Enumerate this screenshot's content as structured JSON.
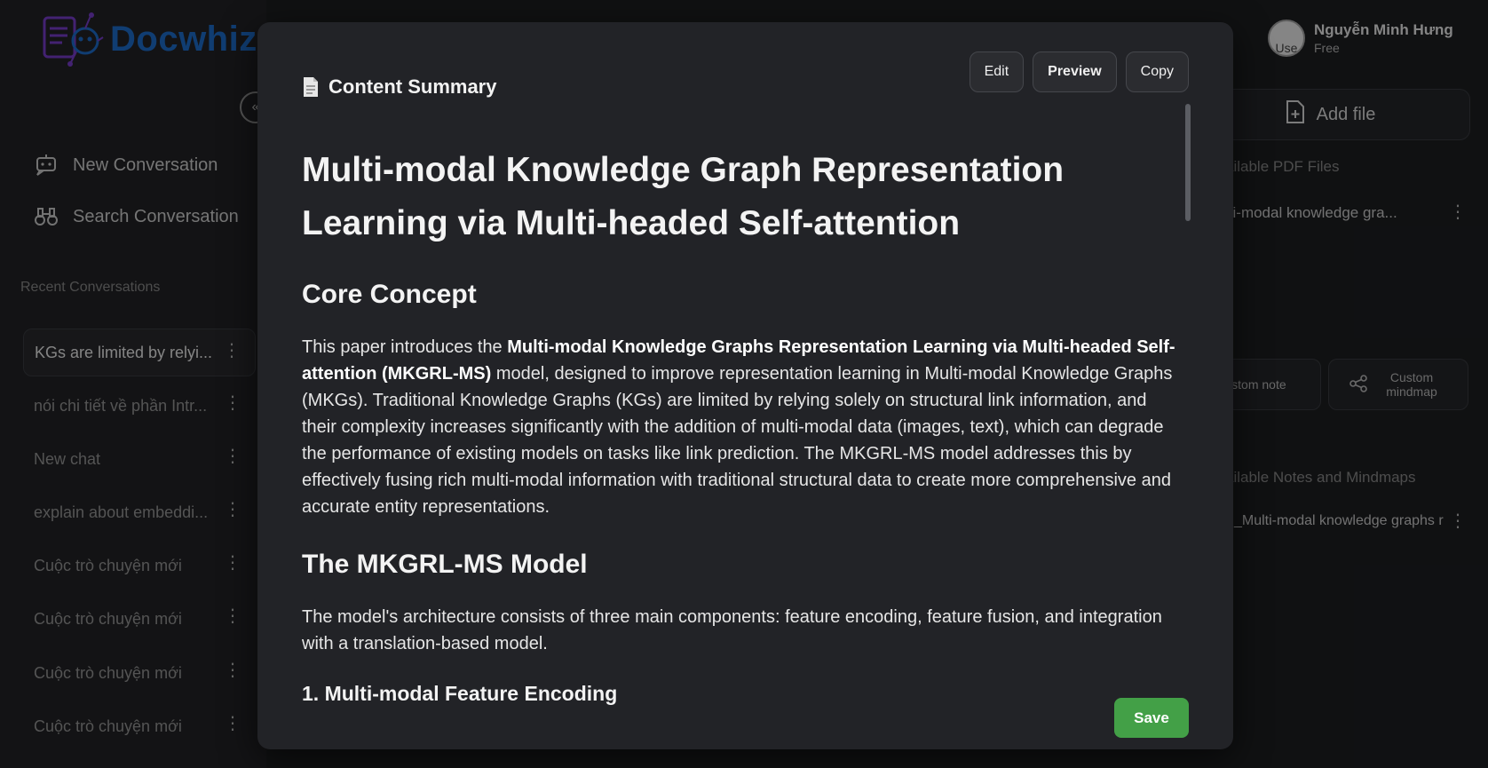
{
  "app": {
    "brand": "Docwhiz",
    "sidebar": {
      "new_conversation": "New Conversation",
      "search_conversation": "Search Conversation",
      "recent_title": "Recent Conversations",
      "conversations": [
        "KGs are limited by relyi...",
        "nói chi tiết về phần Intr...",
        "New chat",
        "explain about embeddi...",
        "Cuộc trò chuyện mới",
        "Cuộc trò chuyện mới",
        "Cuộc trò chuyện mới",
        "Cuộc trò chuyện mới"
      ]
    },
    "user": {
      "name": "Nguyễn Minh Hưng",
      "plan": "Free",
      "avatar_text": "Use"
    },
    "right_panel": {
      "add_file": "Add file",
      "pdf_title": "ailable PDF Files",
      "pdf_item": "lti-modal knowledge gra...",
      "custom_note": "ustom note",
      "custom_mindmap": "Custom mindmap",
      "notes_title": "ailable Notes and Mindmaps",
      "note_item": "_Multi-modal knowledge graphs r"
    }
  },
  "modal": {
    "title": "Content Summary",
    "buttons": {
      "edit": "Edit",
      "preview": "Preview",
      "copy": "Copy",
      "save": "Save"
    },
    "doc_title": "Multi-modal Knowledge Graph Representation Learning via Multi-headed Self-attention",
    "sections": {
      "core_heading": "Core Concept",
      "core_p_start": "This paper introduces the ",
      "core_p_bold": "Multi-modal Knowledge Graphs Representation Learning via Multi-headed Self-attention (MKGRL-MS)",
      "core_p_rest": " model, designed to improve representation learning in Multi-modal Knowledge Graphs (MKGs). Traditional Knowledge Graphs (KGs) are limited by relying solely on structural link information, and their complexity increases significantly with the addition of multi-modal data (images, text), which can degrade the performance of existing models on tasks like link prediction. The MKGRL-MS model addresses this by effectively fusing rich multi-modal information with traditional structural data to create more comprehensive and accurate entity representations.",
      "model_heading": "The MKGRL-MS Model",
      "model_p": "The model's architecture consists of three main components: feature encoding, feature fusion, and integration with a translation-based model.",
      "sub_heading": "1. Multi-modal Feature Encoding"
    }
  }
}
